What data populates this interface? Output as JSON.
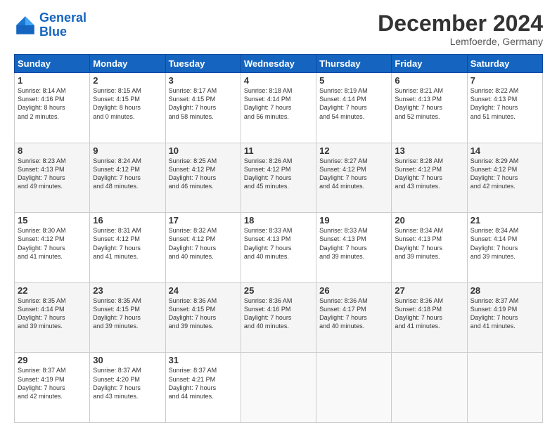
{
  "header": {
    "logo_line1": "General",
    "logo_line2": "Blue",
    "month": "December 2024",
    "location": "Lemfoerde, Germany"
  },
  "weekdays": [
    "Sunday",
    "Monday",
    "Tuesday",
    "Wednesday",
    "Thursday",
    "Friday",
    "Saturday"
  ],
  "weeks": [
    [
      {
        "day": "1",
        "info": "Sunrise: 8:14 AM\nSunset: 4:16 PM\nDaylight: 8 hours\nand 2 minutes."
      },
      {
        "day": "2",
        "info": "Sunrise: 8:15 AM\nSunset: 4:15 PM\nDaylight: 8 hours\nand 0 minutes."
      },
      {
        "day": "3",
        "info": "Sunrise: 8:17 AM\nSunset: 4:15 PM\nDaylight: 7 hours\nand 58 minutes."
      },
      {
        "day": "4",
        "info": "Sunrise: 8:18 AM\nSunset: 4:14 PM\nDaylight: 7 hours\nand 56 minutes."
      },
      {
        "day": "5",
        "info": "Sunrise: 8:19 AM\nSunset: 4:14 PM\nDaylight: 7 hours\nand 54 minutes."
      },
      {
        "day": "6",
        "info": "Sunrise: 8:21 AM\nSunset: 4:13 PM\nDaylight: 7 hours\nand 52 minutes."
      },
      {
        "day": "7",
        "info": "Sunrise: 8:22 AM\nSunset: 4:13 PM\nDaylight: 7 hours\nand 51 minutes."
      }
    ],
    [
      {
        "day": "8",
        "info": "Sunrise: 8:23 AM\nSunset: 4:13 PM\nDaylight: 7 hours\nand 49 minutes."
      },
      {
        "day": "9",
        "info": "Sunrise: 8:24 AM\nSunset: 4:12 PM\nDaylight: 7 hours\nand 48 minutes."
      },
      {
        "day": "10",
        "info": "Sunrise: 8:25 AM\nSunset: 4:12 PM\nDaylight: 7 hours\nand 46 minutes."
      },
      {
        "day": "11",
        "info": "Sunrise: 8:26 AM\nSunset: 4:12 PM\nDaylight: 7 hours\nand 45 minutes."
      },
      {
        "day": "12",
        "info": "Sunrise: 8:27 AM\nSunset: 4:12 PM\nDaylight: 7 hours\nand 44 minutes."
      },
      {
        "day": "13",
        "info": "Sunrise: 8:28 AM\nSunset: 4:12 PM\nDaylight: 7 hours\nand 43 minutes."
      },
      {
        "day": "14",
        "info": "Sunrise: 8:29 AM\nSunset: 4:12 PM\nDaylight: 7 hours\nand 42 minutes."
      }
    ],
    [
      {
        "day": "15",
        "info": "Sunrise: 8:30 AM\nSunset: 4:12 PM\nDaylight: 7 hours\nand 41 minutes."
      },
      {
        "day": "16",
        "info": "Sunrise: 8:31 AM\nSunset: 4:12 PM\nDaylight: 7 hours\nand 41 minutes."
      },
      {
        "day": "17",
        "info": "Sunrise: 8:32 AM\nSunset: 4:12 PM\nDaylight: 7 hours\nand 40 minutes."
      },
      {
        "day": "18",
        "info": "Sunrise: 8:33 AM\nSunset: 4:13 PM\nDaylight: 7 hours\nand 40 minutes."
      },
      {
        "day": "19",
        "info": "Sunrise: 8:33 AM\nSunset: 4:13 PM\nDaylight: 7 hours\nand 39 minutes."
      },
      {
        "day": "20",
        "info": "Sunrise: 8:34 AM\nSunset: 4:13 PM\nDaylight: 7 hours\nand 39 minutes."
      },
      {
        "day": "21",
        "info": "Sunrise: 8:34 AM\nSunset: 4:14 PM\nDaylight: 7 hours\nand 39 minutes."
      }
    ],
    [
      {
        "day": "22",
        "info": "Sunrise: 8:35 AM\nSunset: 4:14 PM\nDaylight: 7 hours\nand 39 minutes."
      },
      {
        "day": "23",
        "info": "Sunrise: 8:35 AM\nSunset: 4:15 PM\nDaylight: 7 hours\nand 39 minutes."
      },
      {
        "day": "24",
        "info": "Sunrise: 8:36 AM\nSunset: 4:15 PM\nDaylight: 7 hours\nand 39 minutes."
      },
      {
        "day": "25",
        "info": "Sunrise: 8:36 AM\nSunset: 4:16 PM\nDaylight: 7 hours\nand 40 minutes."
      },
      {
        "day": "26",
        "info": "Sunrise: 8:36 AM\nSunset: 4:17 PM\nDaylight: 7 hours\nand 40 minutes."
      },
      {
        "day": "27",
        "info": "Sunrise: 8:36 AM\nSunset: 4:18 PM\nDaylight: 7 hours\nand 41 minutes."
      },
      {
        "day": "28",
        "info": "Sunrise: 8:37 AM\nSunset: 4:19 PM\nDaylight: 7 hours\nand 41 minutes."
      }
    ],
    [
      {
        "day": "29",
        "info": "Sunrise: 8:37 AM\nSunset: 4:19 PM\nDaylight: 7 hours\nand 42 minutes."
      },
      {
        "day": "30",
        "info": "Sunrise: 8:37 AM\nSunset: 4:20 PM\nDaylight: 7 hours\nand 43 minutes."
      },
      {
        "day": "31",
        "info": "Sunrise: 8:37 AM\nSunset: 4:21 PM\nDaylight: 7 hours\nand 44 minutes."
      },
      {
        "day": "",
        "info": ""
      },
      {
        "day": "",
        "info": ""
      },
      {
        "day": "",
        "info": ""
      },
      {
        "day": "",
        "info": ""
      }
    ]
  ]
}
